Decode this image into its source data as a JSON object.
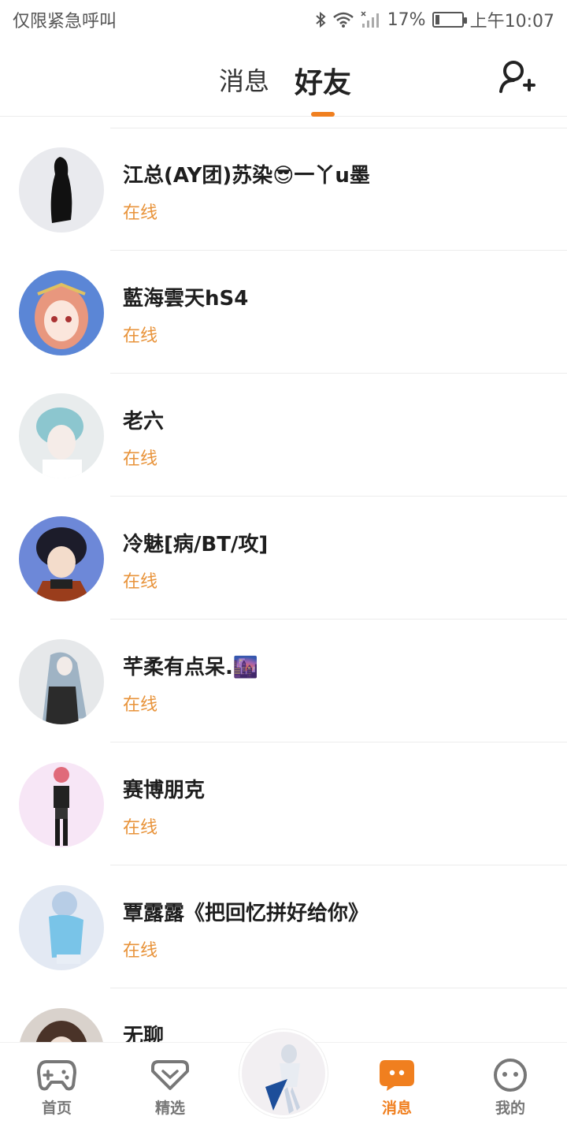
{
  "status_bar": {
    "carrier": "仅限紧急呼叫",
    "battery": "17%",
    "battery_level": 0.17,
    "time": "上午10:07"
  },
  "header": {
    "tabs": [
      {
        "label": "消息",
        "selected": false
      },
      {
        "label": "好友",
        "selected": true
      }
    ],
    "add_friend_icon": "add-user-icon",
    "accent_color": "#f07f1f"
  },
  "friends": [
    {
      "name": "江总(AY团)苏染😎一丫u墨",
      "status": "在线",
      "avatar_color": "#e9eaee"
    },
    {
      "name": "藍海雲天hS4",
      "status": "在线",
      "avatar_color": "#5b86d6"
    },
    {
      "name": "老六",
      "status": "在线",
      "avatar_color": "#e8eced"
    },
    {
      "name": "冷魅[病/BT/攻]",
      "status": "在线",
      "avatar_color": "#6d88d8"
    },
    {
      "name": "芊柔有点呆.🌆",
      "status": "在线",
      "avatar_color": "#e6e8ea"
    },
    {
      "name": "赛博朋克",
      "status": "在线",
      "avatar_color": "#f7e6f6"
    },
    {
      "name": "覃露露《把回忆拼好给你》",
      "status": "在线",
      "avatar_color": "#e3e9f3"
    },
    {
      "name": "无聊",
      "status": "",
      "avatar_color": "#d9d2cc"
    }
  ],
  "status_color": "#e8933a",
  "bottom_nav": {
    "items": [
      {
        "label": "首页",
        "icon": "gamepad-icon",
        "selected": false
      },
      {
        "label": "精选",
        "icon": "heart-chat-icon",
        "selected": false
      },
      {
        "label": "消息",
        "icon": "message-icon",
        "selected": true
      },
      {
        "label": "我的",
        "icon": "face-icon",
        "selected": false
      }
    ]
  }
}
